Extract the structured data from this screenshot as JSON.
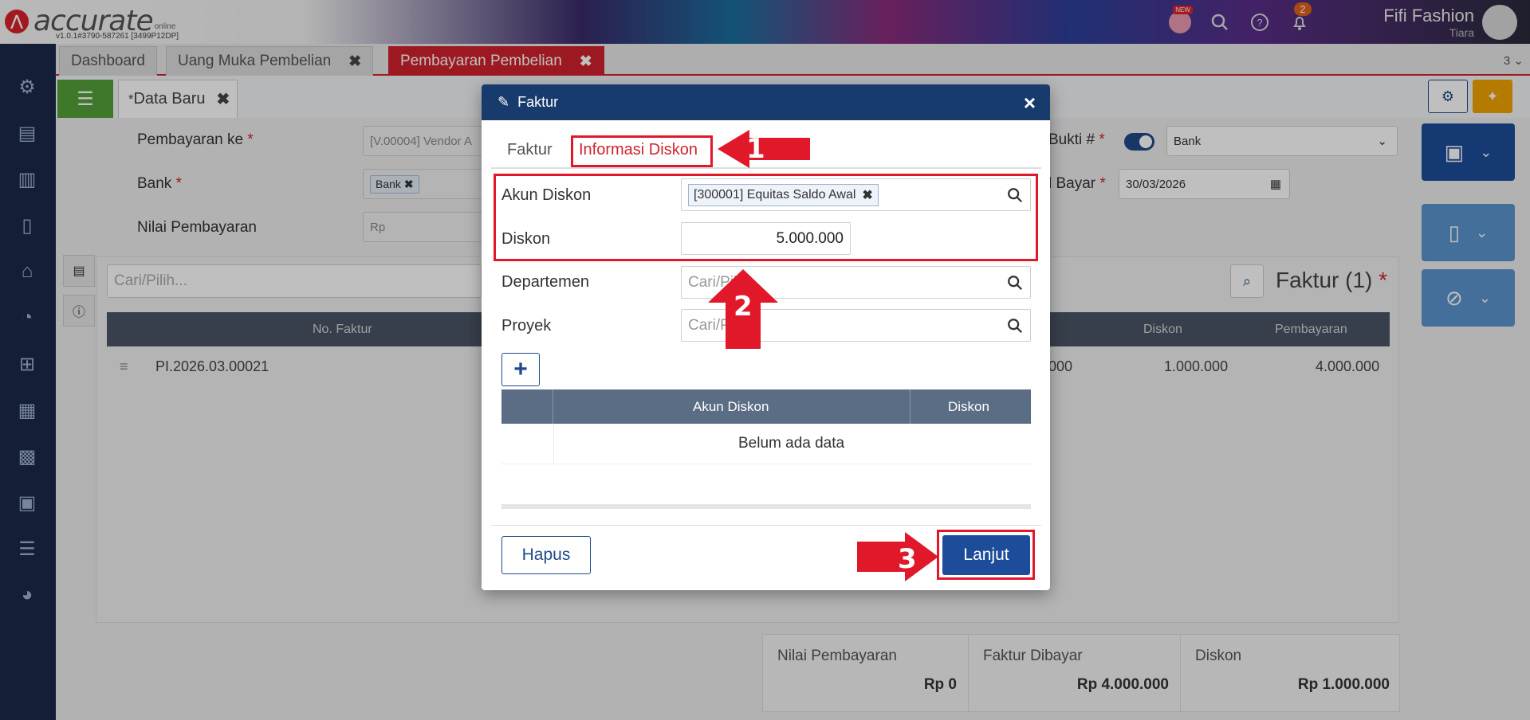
{
  "header": {
    "brand": "accurate",
    "brand_suffix": "online",
    "version": "v1.0.1#3790-587261 [3499P12DP]",
    "new_badge": "NEW",
    "notif_count": "2",
    "user_name": "Fifi Fashion",
    "user_sub": "Tiara"
  },
  "tabs": [
    {
      "label": "Dashboard"
    },
    {
      "label": "Uang Muka Pembelian"
    },
    {
      "label": "Pembayaran Pembelian"
    }
  ],
  "tab_count": "3",
  "subtab": {
    "label": "Data Baru",
    "marker": "*"
  },
  "form": {
    "pembayaran_ke_label": "Pembayaran ke",
    "pembayaran_ke_value": "[V.00004] Vendor A",
    "bank_label": "Bank",
    "bank_chip": "Bank",
    "nilai_label": "Nilai Pembayaran",
    "nilai_placeholder": "Rp",
    "bukti_label": "Bukti #",
    "bukti_value": "Bank",
    "tgl_label": "l Bayar",
    "tgl_value": "30/03/2026"
  },
  "grid": {
    "search_placeholder": "Cari/Pilih...",
    "title": "Faktur (1)",
    "columns": [
      "No. Faktur",
      "Diskon",
      "Pembayaran"
    ],
    "row": {
      "no_faktur": "PI.2026.03.00021",
      "partial": ".000",
      "diskon": "1.000.000",
      "pembayaran": "4.000.000"
    }
  },
  "totals": [
    {
      "label": "Nilai Pembayaran",
      "value": "Rp 0"
    },
    {
      "label": "Faktur Dibayar",
      "value": "Rp 4.000.000"
    },
    {
      "label": "Diskon",
      "value": "Rp 1.000.000"
    }
  ],
  "modal": {
    "title": "Faktur",
    "tabs": [
      "Faktur",
      "Informasi Diskon"
    ],
    "akun_diskon_label": "Akun Diskon",
    "akun_diskon_chip": "[300001] Equitas Saldo Awal",
    "diskon_label": "Diskon",
    "diskon_value": "5.000.000",
    "departemen_label": "Departemen",
    "departemen_placeholder": "Cari/Pilih...",
    "proyek_label": "Proyek",
    "proyek_placeholder": "Cari/Pilih...",
    "table_columns": [
      "Akun Diskon",
      "Diskon"
    ],
    "empty_text": "Belum ada data",
    "hapus_label": "Hapus",
    "lanjut_label": "Lanjut"
  },
  "annotations": [
    "1",
    "2",
    "3"
  ],
  "colors": {
    "accent_red": "#d0222e",
    "navy": "#183b6e",
    "primary_blue": "#1d4d9a",
    "annotation_red": "#e0182a"
  }
}
